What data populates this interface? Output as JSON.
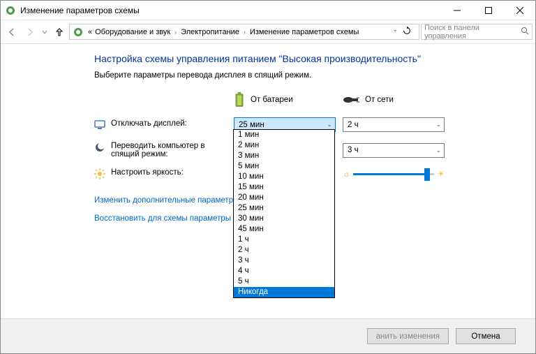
{
  "window": {
    "title": "Изменение параметров схемы"
  },
  "nav": {
    "crumb0": "«",
    "crumb1": "Оборудование и звук",
    "crumb2": "Электропитание",
    "crumb3": "Изменение параметров схемы",
    "search_placeholder": "Поиск в панели управления"
  },
  "heading": "Настройка схемы управления питанием \"Высокая производительность\"",
  "subtext": "Выберите параметры перевода дисплея в спящий режим.",
  "cols": {
    "battery": "От батареи",
    "plugged": "От сети"
  },
  "rows": {
    "display": {
      "label": "Отключать дисплей:",
      "battery": "25 мин",
      "plugged": "2 ч"
    },
    "sleep": {
      "label": "Переводить компьютер в спящий режим:",
      "plugged": "3 ч"
    },
    "brightness": {
      "label": "Настроить яркость:"
    }
  },
  "dropdown_options": [
    "1 мин",
    "2 мин",
    "3 мин",
    "5 мин",
    "10 мин",
    "15 мин",
    "20 мин",
    "25 мин",
    "30 мин",
    "45 мин",
    "1 ч",
    "2 ч",
    "3 ч",
    "4 ч",
    "5 ч",
    "Никогда"
  ],
  "dropdown_selected": "Никогда",
  "links": {
    "advanced": "Изменить дополнительные параметры пи",
    "restore": "Восстановить для схемы параметры по ум"
  },
  "footer": {
    "save_suffix": "анить изменения",
    "cancel": "Отмена"
  }
}
